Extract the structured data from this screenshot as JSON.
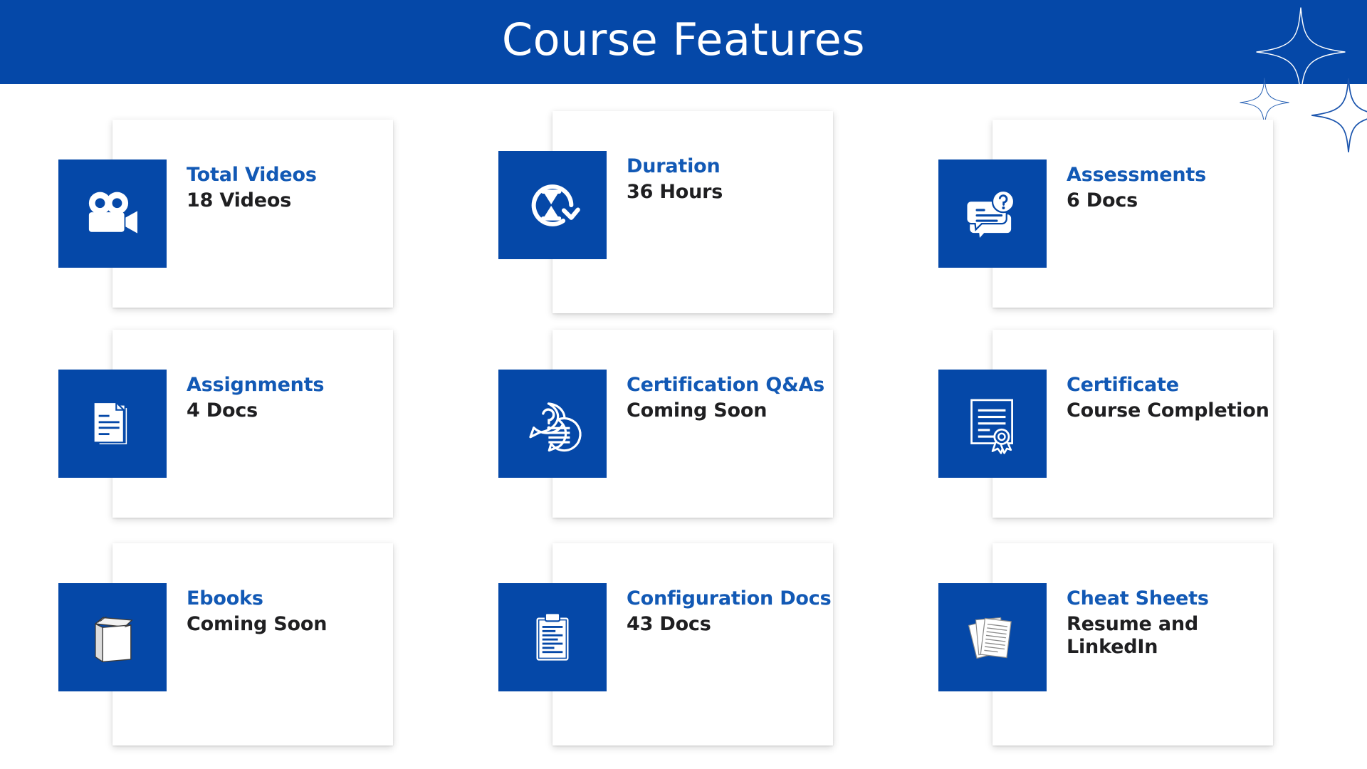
{
  "header": {
    "title": "Course Features",
    "background_color": "#0548a8",
    "title_color": "#ffffff"
  },
  "theme": {
    "brand_blue": "#0548a8",
    "title_blue": "#1259b5",
    "value_dark": "#1f1f21",
    "card_background": "#ffffff",
    "page_background": "#ffffff"
  },
  "decorations": [
    {
      "name": "sparkle-large",
      "color": "#ffffff"
    },
    {
      "name": "sparkle-small",
      "color": "#2a63b5"
    },
    {
      "name": "sparkle-medium",
      "color": "#1a54ad"
    }
  ],
  "cards": [
    {
      "icon": "video-camera-icon",
      "title": "Total Videos",
      "value": "18 Videos"
    },
    {
      "icon": "hourglass-refresh-icon",
      "title": "Duration",
      "value": "36 Hours"
    },
    {
      "icon": "question-chat-card-icon",
      "title": "Assessments",
      "value": "6 Docs"
    },
    {
      "icon": "stacked-documents-icon",
      "title": "Assignments",
      "value": "4 Docs"
    },
    {
      "icon": "chat-bubbles-question-icon",
      "title": "Certification Q&As",
      "value": "Coming Soon"
    },
    {
      "icon": "certificate-ribbon-icon",
      "title": "Certificate",
      "value": "Course Completion"
    },
    {
      "icon": "book-icon",
      "title": "Ebooks",
      "value": "Coming Soon"
    },
    {
      "icon": "clipboard-icon",
      "title": "Configuration Docs",
      "value": "43 Docs"
    },
    {
      "icon": "paper-sheets-icon",
      "title": "Cheat Sheets",
      "value": "Resume and LinkedIn"
    }
  ]
}
